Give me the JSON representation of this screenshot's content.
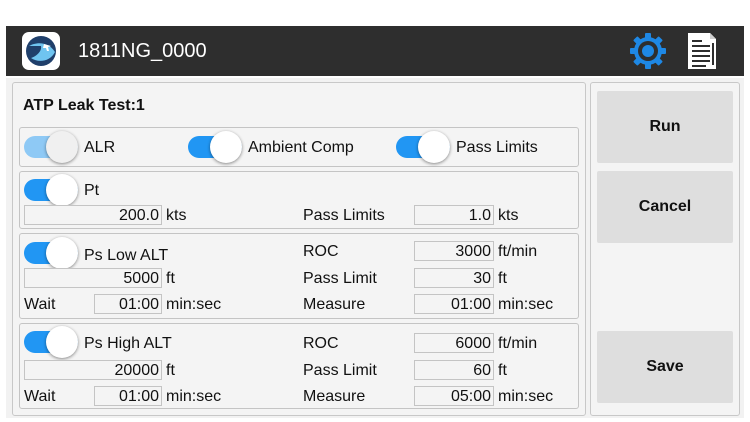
{
  "header": {
    "title": "1811NG_0000"
  },
  "test": {
    "title": "ATP Leak Test:1"
  },
  "options": {
    "alr": "ALR",
    "ambient_comp": "Ambient Comp",
    "pass_limits": "Pass Limits"
  },
  "pt": {
    "label": "Pt",
    "value": "200.0",
    "unit": "kts",
    "pass_limits_label": "Pass Limits",
    "pass_limits_value": "1.0",
    "pass_limits_unit": "kts"
  },
  "ps_low": {
    "label": "Ps Low ALT",
    "alt_value": "5000",
    "alt_unit": "ft",
    "roc_label": "ROC",
    "roc_value": "3000",
    "roc_unit": "ft/min",
    "pass_limit_label": "Pass Limit",
    "pass_limit_value": "30",
    "pass_limit_unit": "ft",
    "wait_label": "Wait",
    "wait_value": "01:00",
    "wait_unit": "min:sec",
    "measure_label": "Measure",
    "measure_value": "01:00",
    "measure_unit": "min:sec"
  },
  "ps_high": {
    "label": "Ps High ALT",
    "alt_value": "20000",
    "alt_unit": "ft",
    "roc_label": "ROC",
    "roc_value": "6000",
    "roc_unit": "ft/min",
    "pass_limit_label": "Pass Limit",
    "pass_limit_value": "60",
    "pass_limit_unit": "ft",
    "wait_label": "Wait",
    "wait_value": "01:00",
    "wait_unit": "min:sec",
    "measure_label": "Measure",
    "measure_value": "05:00",
    "measure_unit": "min:sec"
  },
  "buttons": {
    "run": "Run",
    "cancel": "Cancel",
    "save": "Save"
  },
  "icons": {
    "logo": "app-logo-icon",
    "settings": "gear-icon",
    "report": "document-icon"
  },
  "colors": {
    "accent": "#2196f3",
    "titlebar": "#2e2e2e"
  }
}
